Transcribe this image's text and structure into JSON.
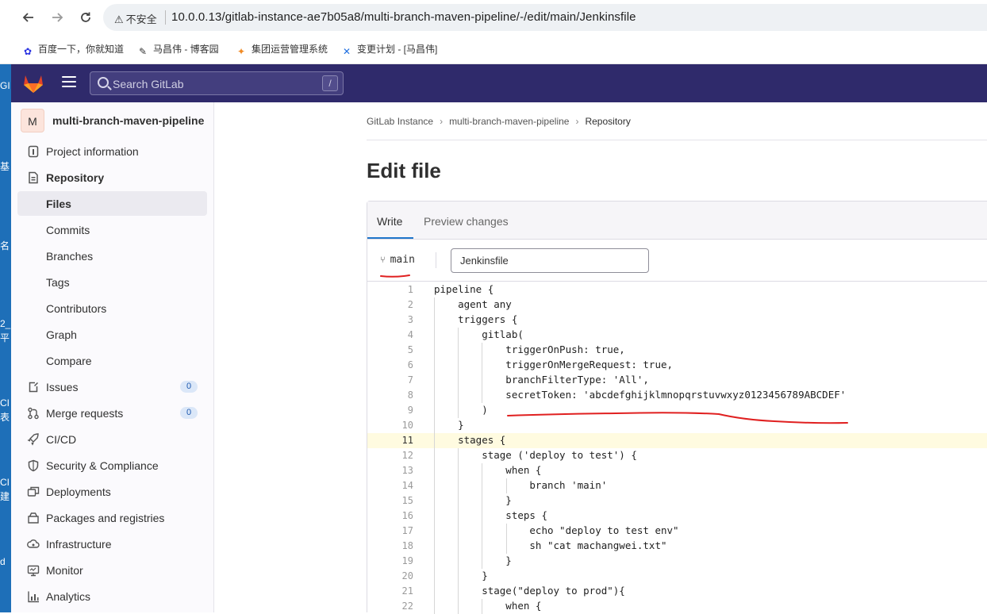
{
  "browser": {
    "insecure_label": "不安全",
    "url": "10.0.0.13/gitlab-instance-ae7b05a8/multi-branch-maven-pipeline/-/edit/main/Jenkinsfile",
    "bookmarks": [
      {
        "label": "百度一下，你就知道",
        "icon": "baidu-paw-icon"
      },
      {
        "label": "马昌伟 - 博客园",
        "icon": "blog-pen-icon"
      },
      {
        "label": "集团运营管理系统",
        "icon": "flame-icon"
      },
      {
        "label": "变更计划 - [马昌伟]",
        "icon": "confluence-icon"
      }
    ]
  },
  "desktop_fragments": [
    "GI",
    "基",
    "名",
    "2_",
    "平",
    "CI",
    "表",
    "CI",
    "建",
    "d"
  ],
  "gitlab": {
    "search_placeholder": "Search GitLab",
    "search_shortcut": "/"
  },
  "sidebar": {
    "project_avatar": "M",
    "project_name": "multi-branch-maven-pipeline",
    "items": [
      {
        "label": "Project information",
        "icon": "info-icon"
      },
      {
        "label": "Repository",
        "icon": "document-icon"
      },
      {
        "label": "Files",
        "icon": ""
      },
      {
        "label": "Commits",
        "icon": ""
      },
      {
        "label": "Branches",
        "icon": ""
      },
      {
        "label": "Tags",
        "icon": ""
      },
      {
        "label": "Contributors",
        "icon": ""
      },
      {
        "label": "Graph",
        "icon": ""
      },
      {
        "label": "Compare",
        "icon": ""
      },
      {
        "label": "Issues",
        "icon": "issues-icon",
        "badge": "0"
      },
      {
        "label": "Merge requests",
        "icon": "merge-request-icon",
        "badge": "0"
      },
      {
        "label": "CI/CD",
        "icon": "rocket-icon"
      },
      {
        "label": "Security & Compliance",
        "icon": "shield-icon"
      },
      {
        "label": "Deployments",
        "icon": "deployments-icon"
      },
      {
        "label": "Packages and registries",
        "icon": "package-icon"
      },
      {
        "label": "Infrastructure",
        "icon": "cloud-gear-icon"
      },
      {
        "label": "Monitor",
        "icon": "monitor-icon"
      },
      {
        "label": "Analytics",
        "icon": "chart-icon"
      }
    ]
  },
  "breadcrumb": [
    "GitLab Instance",
    "multi-branch-maven-pipeline",
    "Repository"
  ],
  "page_title": "Edit file",
  "editor": {
    "tabs": [
      "Write",
      "Preview changes"
    ],
    "branch": "main",
    "filename": "Jenkinsfile",
    "lines": [
      "pipeline {",
      "    agent any",
      "    triggers {",
      "        gitlab(",
      "            triggerOnPush: true,",
      "            triggerOnMergeRequest: true,",
      "            branchFilterType: 'All',",
      "            secretToken: 'abcdefghijklmnopqrstuvwxyz0123456789ABCDEF'",
      "        )",
      "    }",
      "    stages {",
      "        stage ('deploy to test') {",
      "            when {",
      "                branch 'main'",
      "            }",
      "            steps {",
      "                echo \"deploy to test env\"",
      "                sh \"cat machangwei.txt\"",
      "            }",
      "        }",
      "        stage(\"deploy to prod\"){",
      "            when {"
    ],
    "highlighted_line": 11,
    "annotation_color": "#e02020"
  }
}
